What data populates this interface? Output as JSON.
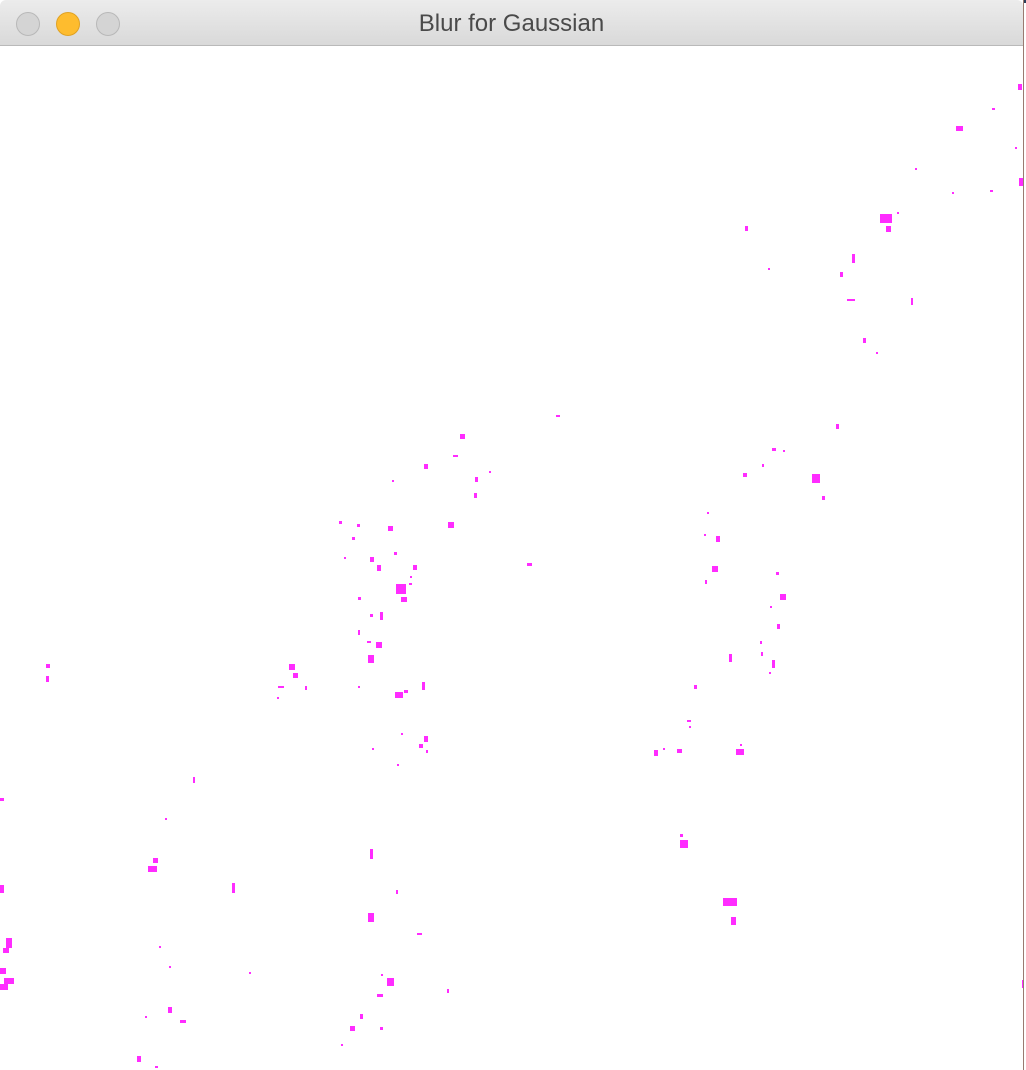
{
  "window": {
    "title": "Blur for Gaussian"
  },
  "colors": {
    "background": "#ffffff",
    "dots": "#ff2cff",
    "titlebar": "#e2e2e2",
    "minimize": "#febc2e"
  }
}
